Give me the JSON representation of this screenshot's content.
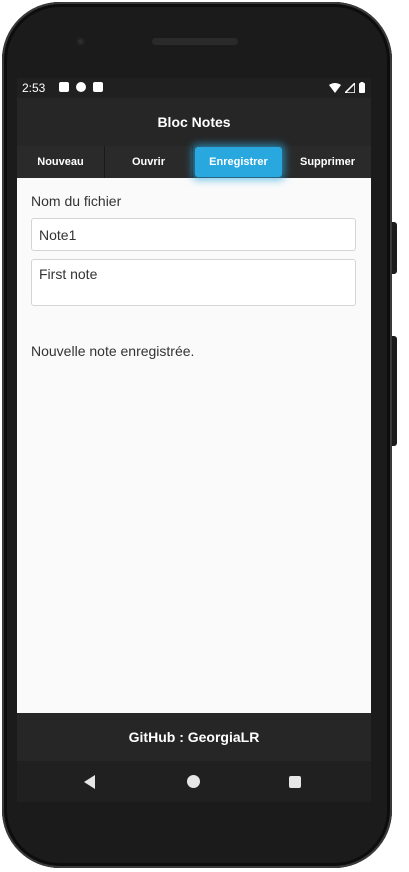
{
  "status_bar": {
    "time": "2:53",
    "left_icons": [
      "notification-a-icon",
      "notification-p-icon",
      "sd-card-icon"
    ],
    "right_icons": [
      "wifi-icon",
      "signal-icon",
      "battery-icon"
    ]
  },
  "app_bar": {
    "title": "Bloc Notes"
  },
  "tabs": [
    {
      "label": "Nouveau",
      "active": false
    },
    {
      "label": "Ouvrir",
      "active": false
    },
    {
      "label": "Enregistrer",
      "active": true
    },
    {
      "label": "Supprimer",
      "active": false
    }
  ],
  "form": {
    "filename_label": "Nom du fichier",
    "filename_value": "Note1",
    "note_value": "First note"
  },
  "status_message": "Nouvelle note enregistrée.",
  "footer": {
    "text": "GitHub : GeorgiaLR"
  },
  "nav_bar": {
    "icons": [
      "back-icon",
      "home-icon",
      "recent-apps-icon"
    ]
  },
  "colors": {
    "accent": "#29a8e0",
    "bar_dark": "#262626",
    "background": "#fafafa"
  }
}
